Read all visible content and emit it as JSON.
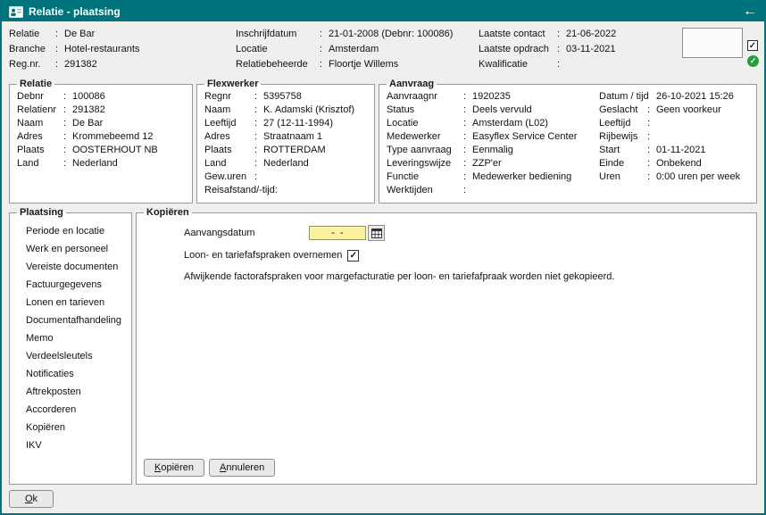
{
  "colon": ":",
  "icons": {
    "back_arrow": "←",
    "check": "✓"
  },
  "titlebar": {
    "title": "Relatie - plaatsing"
  },
  "header": {
    "col1": [
      {
        "label": "Relatie",
        "value": "De Bar"
      },
      {
        "label": "Branche",
        "value": "Hotel-restaurants"
      },
      {
        "label": "Reg.nr.",
        "value": "291382"
      }
    ],
    "col2": [
      {
        "label": "Inschrijfdatum",
        "value": "21-01-2008  (Debnr: 100086)"
      },
      {
        "label": "Locatie",
        "value": "Amsterdam"
      },
      {
        "label": "Relatiebeheerde",
        "value": "Floortje Willems"
      }
    ],
    "col3": [
      {
        "label": "Laatste contact",
        "value": "21-06-2022"
      },
      {
        "label": "Laatste opdrach",
        "value": "03-11-2021"
      },
      {
        "label": "Kwalificatie",
        "value": ""
      }
    ]
  },
  "relatie": {
    "legend": "Relatie",
    "rows": [
      {
        "label": "Debnr",
        "value": "100086"
      },
      {
        "label": "Relatienr",
        "value": "291382"
      },
      {
        "label": "Naam",
        "value": "De Bar"
      },
      {
        "label": "Adres",
        "value": "Krommebeemd 12"
      },
      {
        "label": "Plaats",
        "value": "OOSTERHOUT NB"
      },
      {
        "label": "Land",
        "value": "Nederland"
      }
    ]
  },
  "flexwerker": {
    "legend": "Flexwerker",
    "rows": [
      {
        "label": "Regnr",
        "value": "5395758"
      },
      {
        "label": "Naam",
        "value": "K. Adamski (Krisztof)"
      },
      {
        "label": "Leeftijd",
        "value": "27 (12-11-1994)"
      },
      {
        "label": "Adres",
        "value": "Straatnaam 1"
      },
      {
        "label": "Plaats",
        "value": "ROTTERDAM"
      },
      {
        "label": "Land",
        "value": "Nederland"
      },
      {
        "label": "Gew.uren",
        "value": ""
      }
    ],
    "last_row_label": "Reisafstand/-tijd:"
  },
  "aanvraag": {
    "legend": "Aanvraag",
    "left": [
      {
        "label": "Aanvraagnr",
        "value": "1920235"
      },
      {
        "label": "Status",
        "value": "Deels vervuld"
      },
      {
        "label": "Locatie",
        "value": "Amsterdam (L02)"
      },
      {
        "label": "Medewerker",
        "value": "Easyflex Service Center"
      },
      {
        "label": "Type aanvraag",
        "value": "Eenmalig"
      },
      {
        "label": "Leveringswijze",
        "value": "ZZP'er"
      },
      {
        "label": "Functie",
        "value": "Medewerker bediening"
      },
      {
        "label": "Werktijden",
        "value": ""
      }
    ],
    "datum_label": "Datum / tijd",
    "datum_value": "26-10-2021 15:26",
    "right": [
      {
        "label": "Geslacht",
        "value": "Geen voorkeur"
      },
      {
        "label": "Leeftijd",
        "value": ""
      },
      {
        "label": "Rijbewijs",
        "value": ""
      },
      {
        "label": "Start",
        "value": "01-11-2021"
      },
      {
        "label": "Einde",
        "value": "Onbekend"
      },
      {
        "label": "Uren",
        "value": "0:00 uren per week"
      }
    ]
  },
  "plaatsing": {
    "legend": "Plaatsing",
    "items": [
      "Periode en locatie",
      "Werk en personeel",
      "Vereiste documenten",
      "Factuurgegevens",
      "Lonen en tarieven",
      "Documentafhandeling",
      "Memo",
      "Verdeelsleutels",
      "Notificaties",
      "Aftrekposten",
      "Accorderen",
      "Kopiëren",
      "IKV"
    ]
  },
  "kopieren": {
    "legend": "Kopiëren",
    "aanvangsdatum_label": "Aanvangsdatum",
    "aanvangsdatum_value": "-  -",
    "overnemen_label": "Loon- en tariefafspraken overnemen",
    "note": "Afwijkende factorafspraken voor margefacturatie per loon- en tariefafpraak worden niet gekopieerd.",
    "kopieren_button": {
      "key": "K",
      "rest": "opiëren"
    },
    "annuleren_button": {
      "key": "A",
      "rest": "nnuleren"
    }
  },
  "footer": {
    "ok_button": {
      "key": "O",
      "rest": "k"
    }
  }
}
